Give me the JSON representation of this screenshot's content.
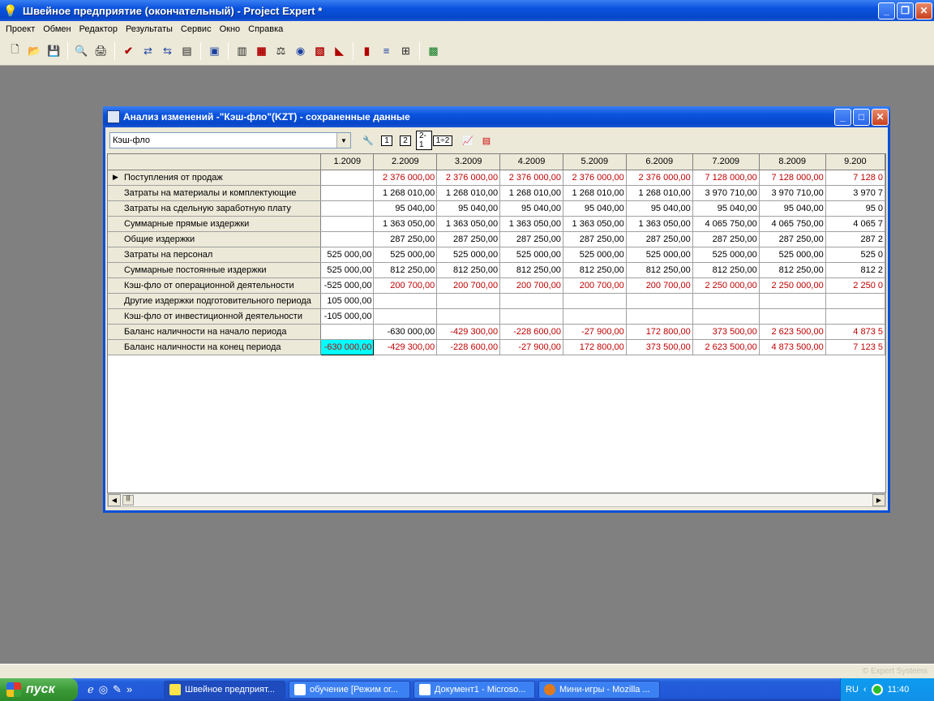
{
  "window": {
    "title": "Швейное предприятие (окончательный) - Project Expert *"
  },
  "menu": [
    "Проект",
    "Обмен",
    "Редактор",
    "Результаты",
    "Сервис",
    "Окно",
    "Справка"
  ],
  "toolbar_icons": [
    "new-icon",
    "open-icon",
    "save-icon",
    "preview-icon",
    "print-icon",
    "check-icon",
    "compare-icon",
    "transfer-icon",
    "notes-icon",
    "screen-icon",
    "calendar-icon",
    "cashflow-icon",
    "balance-icon",
    "calc-icon",
    "report-icon",
    "chart-icon",
    "bar-chart-icon",
    "npv-icon",
    "structure-icon",
    "export-icon"
  ],
  "child": {
    "title": "Анализ изменений -\"Кэш-фло\"(KZT) - сохраненные данные",
    "combo_value": "Кэш-фло",
    "toolbar_buttons": {
      "b1": "1",
      "b2": "2",
      "b3": "2-1",
      "b4": "1÷2"
    }
  },
  "table": {
    "columns": [
      "1.2009",
      "2.2009",
      "3.2009",
      "4.2009",
      "5.2009",
      "6.2009",
      "7.2009",
      "8.2009",
      "9.200"
    ],
    "rows": [
      {
        "label": "Поступления от продаж",
        "red": true,
        "values": [
          "",
          "2 376 000,00",
          "2 376 000,00",
          "2 376 000,00",
          "2 376 000,00",
          "2 376 000,00",
          "7 128 000,00",
          "7 128 000,00",
          "7 128 0"
        ]
      },
      {
        "label": "Затраты на материалы и комплектующие",
        "red": false,
        "values": [
          "",
          "1 268 010,00",
          "1 268 010,00",
          "1 268 010,00",
          "1 268 010,00",
          "1 268 010,00",
          "3 970 710,00",
          "3 970 710,00",
          "3 970 7"
        ]
      },
      {
        "label": "Затраты на сдельную заработную плату",
        "red": false,
        "values": [
          "",
          "95 040,00",
          "95 040,00",
          "95 040,00",
          "95 040,00",
          "95 040,00",
          "95 040,00",
          "95 040,00",
          "95 0"
        ]
      },
      {
        "label": "Суммарные прямые издержки",
        "red": false,
        "values": [
          "",
          "1 363 050,00",
          "1 363 050,00",
          "1 363 050,00",
          "1 363 050,00",
          "1 363 050,00",
          "4 065 750,00",
          "4 065 750,00",
          "4 065 7"
        ]
      },
      {
        "label": "Общие издержки",
        "red": false,
        "values": [
          "",
          "287 250,00",
          "287 250,00",
          "287 250,00",
          "287 250,00",
          "287 250,00",
          "287 250,00",
          "287 250,00",
          "287 2"
        ]
      },
      {
        "label": "Затраты на персонал",
        "red": false,
        "values": [
          "525 000,00",
          "525 000,00",
          "525 000,00",
          "525 000,00",
          "525 000,00",
          "525 000,00",
          "525 000,00",
          "525 000,00",
          "525 0"
        ]
      },
      {
        "label": "Суммарные постоянные издержки",
        "red": false,
        "values": [
          "525 000,00",
          "812 250,00",
          "812 250,00",
          "812 250,00",
          "812 250,00",
          "812 250,00",
          "812 250,00",
          "812 250,00",
          "812 2"
        ]
      },
      {
        "label": "Кэш-фло от операционной деятельности",
        "red": true,
        "firstBlack": true,
        "values": [
          "-525 000,00",
          "200 700,00",
          "200 700,00",
          "200 700,00",
          "200 700,00",
          "200 700,00",
          "2 250 000,00",
          "2 250 000,00",
          "2 250 0"
        ]
      },
      {
        "label": "Другие издержки подготовительного периода",
        "red": false,
        "values": [
          "105 000,00",
          "",
          "",
          "",
          "",
          "",
          "",
          "",
          ""
        ]
      },
      {
        "label": "Кэш-фло от инвестиционной деятельности",
        "red": false,
        "values": [
          "-105 000,00",
          "",
          "",
          "",
          "",
          "",
          "",
          "",
          ""
        ]
      },
      {
        "label": "Баланс наличности на начало периода",
        "red": true,
        "firstBlack": true,
        "blackCols": [
          1
        ],
        "values": [
          "",
          "-630 000,00",
          "-429 300,00",
          "-228 600,00",
          "-27 900,00",
          "172 800,00",
          "373 500,00",
          "2 623 500,00",
          "4 873 5"
        ]
      },
      {
        "label": "Баланс наличности на конец периода",
        "red": true,
        "selectedCol": 0,
        "values": [
          "-630 000,00",
          "-429 300,00",
          "-228 600,00",
          "-27 900,00",
          "172 800,00",
          "373 500,00",
          "2 623 500,00",
          "4 873 500,00",
          "7 123 5"
        ]
      }
    ]
  },
  "status": {
    "watermark": "© Expert Systems"
  },
  "taskbar": {
    "start_label": "пуск",
    "tasks": [
      "Швейное предприят...",
      "обучение [Режим ог...",
      "Документ1 - Microso...",
      "Мини-игры - Mozilla ..."
    ],
    "lang": "RU",
    "clock": "11:40"
  }
}
